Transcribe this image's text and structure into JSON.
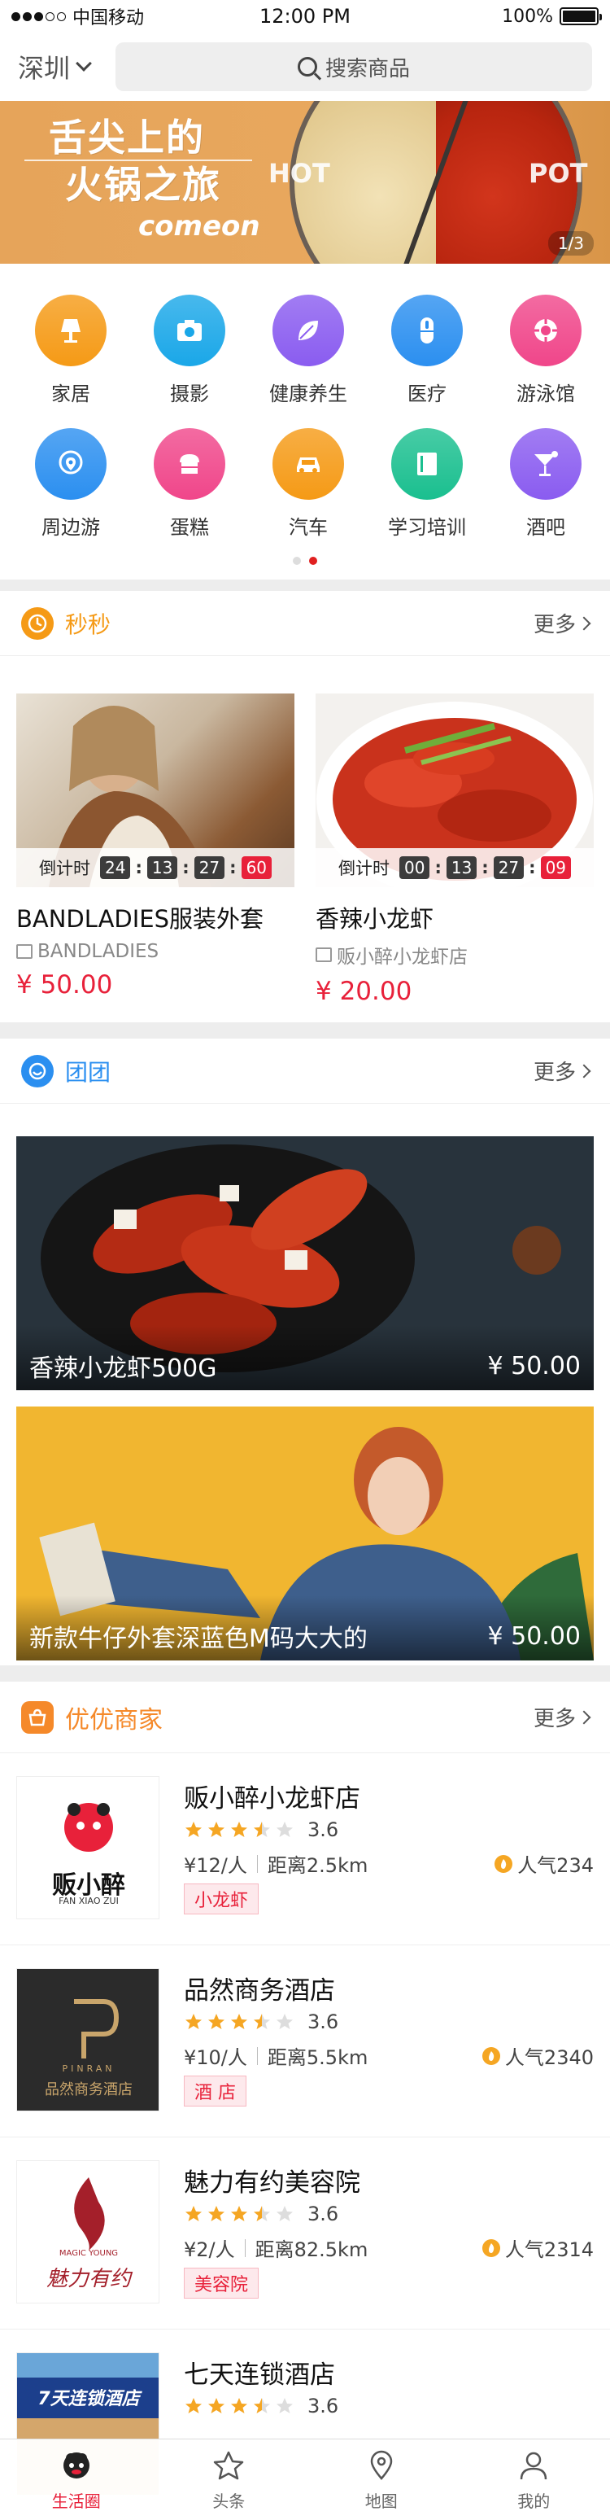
{
  "status_bar": {
    "carrier": "中国移动",
    "time": "12:00 PM",
    "battery": "100%",
    "battery_level": 1.0
  },
  "header": {
    "city": "深圳",
    "search_placeholder": "搜索商品"
  },
  "banner": {
    "title_line1": "舌尖上的",
    "title_line2": "火锅之旅",
    "subtitle": "comeon",
    "en_left": "HOT",
    "en_right": "POT",
    "counter": "1/3"
  },
  "categories": [
    {
      "label": "家居",
      "icon": "lamp-icon",
      "color": "#f59a16"
    },
    {
      "label": "摄影",
      "icon": "camera-icon",
      "color": "#1aa7e8"
    },
    {
      "label": "健康养生",
      "icon": "leaf-icon",
      "color": "#8a5cf0"
    },
    {
      "label": "医疗",
      "icon": "pill-icon",
      "color": "#2b8ff0"
    },
    {
      "label": "游泳馆",
      "icon": "lifebuoy-icon",
      "color": "#f0468a"
    },
    {
      "label": "周边游",
      "icon": "location-icon",
      "color": "#2b8ff0"
    },
    {
      "label": "蛋糕",
      "icon": "cake-icon",
      "color": "#f0468a"
    },
    {
      "label": "汽车",
      "icon": "car-icon",
      "color": "#f59a16"
    },
    {
      "label": "学习培训",
      "icon": "book-icon",
      "color": "#1abf8f"
    },
    {
      "label": "酒吧",
      "icon": "cocktail-icon",
      "color": "#8a5cf0"
    }
  ],
  "flash_sale": {
    "title": "秒秒",
    "more": "更多",
    "countdown_label": "倒计时",
    "items": [
      {
        "name": "BANDLADIES服装外套",
        "shop": "BANDLADIES",
        "price": "¥ 50.00",
        "time": [
          "24",
          "13",
          "27",
          "60"
        ]
      },
      {
        "name": "香辣小龙虾",
        "shop": "贩小醉小龙虾店",
        "price": "¥ 20.00",
        "time": [
          "00",
          "13",
          "27",
          "09"
        ]
      }
    ]
  },
  "group_buy": {
    "title": "团团",
    "more": "更多",
    "items": [
      {
        "name": "香辣小龙虾500G",
        "price": "¥ 50.00"
      },
      {
        "name": "新款牛仔外套深蓝色M码大大的",
        "price": "¥ 50.00"
      }
    ]
  },
  "merchants": {
    "title": "优优商家",
    "more": "更多",
    "items": [
      {
        "name": "贩小醉小龙虾店",
        "rating": "3.6",
        "rating_value": 3.6,
        "price": "¥12/人",
        "distance": "距离2.5km",
        "popularity": "人气234",
        "tag": "小龙虾",
        "logo_text": "贩小醉",
        "logo_sub": "FAN XIAO ZUI"
      },
      {
        "name": "品然商务酒店",
        "rating": "3.6",
        "rating_value": 3.6,
        "price": "¥10/人",
        "distance": "距离5.5km",
        "popularity": "人气2340",
        "tag": "酒 店",
        "logo_text": "品然商务酒店",
        "logo_sub": "PINRAN"
      },
      {
        "name": "魅力有约美容院",
        "rating": "3.6",
        "rating_value": 3.6,
        "price": "¥2/人",
        "distance": "距离82.5km",
        "popularity": "人气2314",
        "tag": "美容院",
        "logo_text": "魅力有约",
        "logo_sub": "MAGIC YOUNG"
      },
      {
        "name": "七天连锁酒店",
        "rating": "3.6",
        "rating_value": 3.6,
        "price": "",
        "distance": "",
        "popularity": "",
        "tag": "",
        "logo_text": "7天连锁酒店",
        "logo_sub": ""
      }
    ]
  },
  "tabbar": [
    {
      "label": "生活圈",
      "icon": "life-circle-icon",
      "active": true
    },
    {
      "label": "头条",
      "icon": "star-icon",
      "active": false
    },
    {
      "label": "地图",
      "icon": "map-pin-icon",
      "active": false
    },
    {
      "label": "我的",
      "icon": "user-icon",
      "active": false
    }
  ],
  "colors": {
    "accent": "#e8213a",
    "orange": "#f59a16",
    "blue": "#2b8ff0"
  }
}
